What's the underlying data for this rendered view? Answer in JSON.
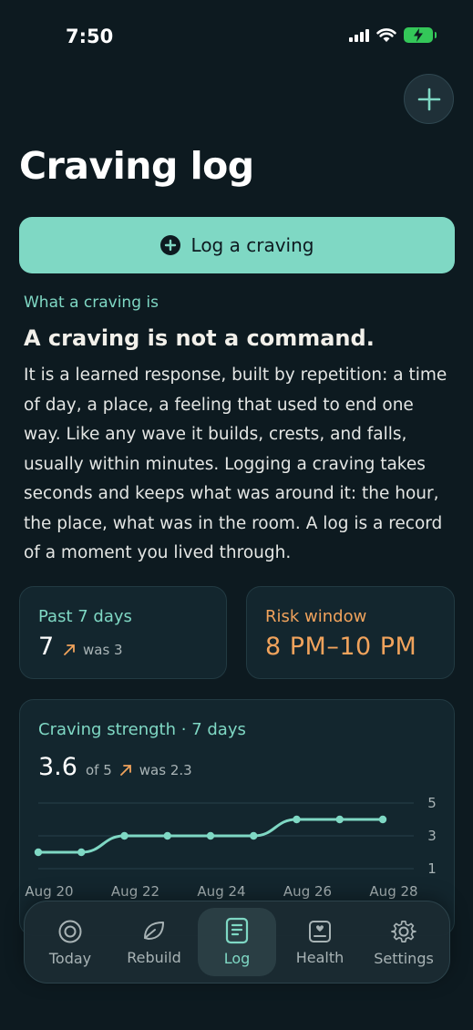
{
  "status": {
    "time": "7:50"
  },
  "header": {
    "title": "Craving log",
    "add_icon": "plus-icon"
  },
  "log_button": {
    "label": "Log a craving",
    "icon": "plus-circle-icon"
  },
  "info": {
    "kicker": "What a craving is",
    "heading": "A craving is not a command.",
    "body": "It is a learned response, built by repetition: a time of day, a place, a feeling that used to end one way. Like any wave it builds, crests, and falls, usually within minutes. Logging a craving takes seconds and keeps what was around it: the hour, the place, what was in the room. A log is a record of a moment you lived through."
  },
  "past7": {
    "label": "Past 7 days",
    "value": "7",
    "was": "was 3"
  },
  "risk": {
    "label": "Risk window",
    "value": "8 PM–10 PM"
  },
  "strength": {
    "title": "Craving strength · 7 days",
    "avg": "3.6",
    "of": "of 5",
    "was": "was 2.3"
  },
  "chart_data": {
    "type": "line",
    "x": [
      "Aug 20",
      "Aug 21",
      "Aug 22",
      "Aug 23",
      "Aug 24",
      "Aug 25",
      "Aug 26",
      "Aug 27",
      "Aug 28"
    ],
    "x_tick_labels": [
      "Aug 20",
      "Aug 22",
      "Aug 24",
      "Aug 26",
      "Aug 28"
    ],
    "values": [
      2,
      2,
      3,
      3,
      3,
      3,
      4,
      4,
      4
    ],
    "y_tick_labels": [
      "5",
      "3",
      "1"
    ],
    "ylim": [
      1,
      5
    ],
    "grid": true,
    "color": "#7fd8c4"
  },
  "tabs": [
    {
      "label": "Today",
      "icon": "target-icon",
      "active": false
    },
    {
      "label": "Rebuild",
      "icon": "leaf-icon",
      "active": false
    },
    {
      "label": "Log",
      "icon": "document-icon",
      "active": true
    },
    {
      "label": "Health",
      "icon": "health-card-icon",
      "active": false
    },
    {
      "label": "Settings",
      "icon": "gear-icon",
      "active": false
    }
  ],
  "colors": {
    "accent": "#7fd8c4",
    "warning": "#f1a35c",
    "background": "#0d1a20",
    "card": "#13262e"
  }
}
